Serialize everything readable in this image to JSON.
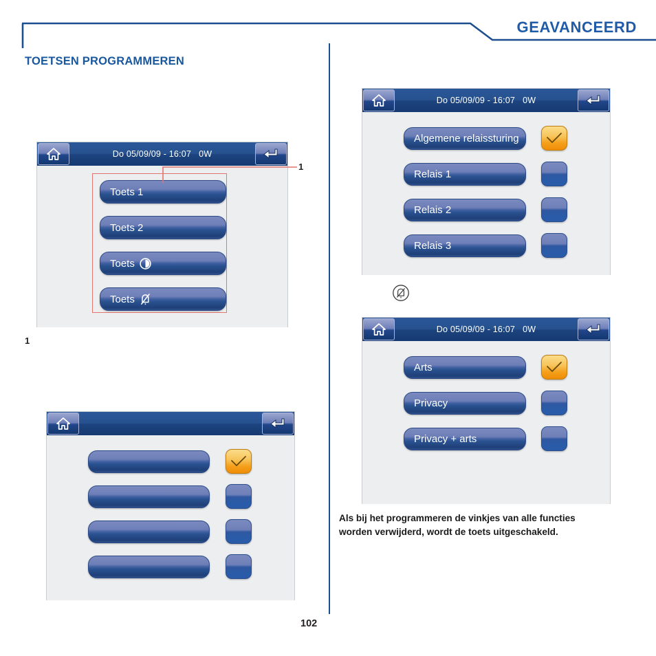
{
  "header": {
    "title": "GEAVANCEERD"
  },
  "section": {
    "title": "TOETSEN PROGRAMMEREN"
  },
  "screens": {
    "keys_list": {
      "titlebar": {
        "home_icon": "home-icon",
        "title": "Do 05/09/09 - 16:07   0W",
        "back_icon": "return-arrow-icon"
      },
      "rows": [
        {
          "label": "Toets 1",
          "glyph": ""
        },
        {
          "label": "Toets 2",
          "glyph": ""
        },
        {
          "label": "Toets",
          "glyph": "brightness-icon"
        },
        {
          "label": "Toets",
          "glyph": "bell-muted-icon"
        }
      ],
      "callout_number": "1"
    },
    "blank_options": {
      "titlebar": {
        "home_icon": "home-icon",
        "title": "",
        "back_icon": "return-arrow-icon"
      },
      "rows": [
        {
          "label": "",
          "checked": true
        },
        {
          "label": "",
          "checked": false
        },
        {
          "label": "",
          "checked": false
        },
        {
          "label": "",
          "checked": false
        }
      ]
    },
    "relay_options": {
      "titlebar": {
        "home_icon": "home-icon",
        "title": "Do 05/09/09 - 16:07   0W",
        "back_icon": "return-arrow-icon"
      },
      "rows": [
        {
          "label": "Algemene relaissturing",
          "checked": true
        },
        {
          "label": "Relais 1",
          "checked": false
        },
        {
          "label": "Relais 2",
          "checked": false
        },
        {
          "label": "Relais 3",
          "checked": false
        }
      ]
    },
    "privacy_options": {
      "titlebar": {
        "home_icon": "home-icon",
        "title": "Do 05/09/09 - 16:07   0W",
        "back_icon": "return-arrow-icon"
      },
      "rows": [
        {
          "label": "Arts",
          "checked": true
        },
        {
          "label": "Privacy",
          "checked": false
        },
        {
          "label": "Privacy + arts",
          "checked": false
        }
      ]
    }
  },
  "markers": {
    "callout_one_top": "1",
    "callout_one_bottom": "1",
    "mute_marker_icon": "bell-muted-circled-icon"
  },
  "note": {
    "line1": "Als bij het programmeren de vinkjes van alle functies",
    "line2": "worden verwijderd, wordt de toets uitgeschakeld."
  },
  "footer": {
    "page_number": "102"
  },
  "colors": {
    "brand_blue": "#1f5ba8",
    "rule_blue": "#1c4f8f",
    "callout_red": "#e2736e",
    "checked_orange": "#f4a01c",
    "screen_bg": "#eceef0"
  }
}
